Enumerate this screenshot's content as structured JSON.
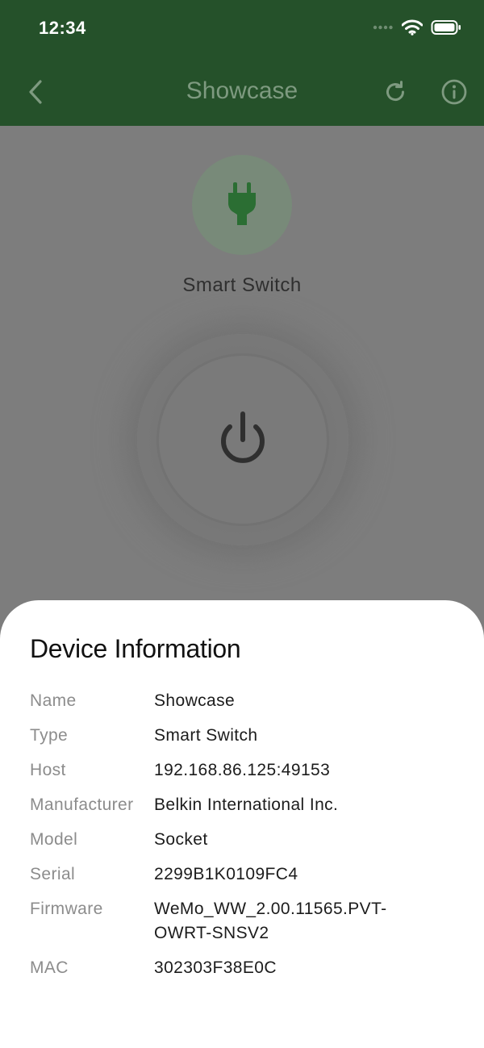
{
  "status_bar": {
    "time": "12:34",
    "icons": [
      "signal-dots-icon",
      "wifi-icon",
      "battery-icon"
    ]
  },
  "nav": {
    "title": "Showcase",
    "icons": [
      "back-chevron-icon",
      "refresh-icon",
      "info-icon"
    ]
  },
  "device": {
    "type_label": "Smart Switch",
    "icon": "plug-icon",
    "power_icon": "power-icon"
  },
  "colors": {
    "header_green": "#25512a",
    "accent_green": "#2b6e33",
    "scrim_gray": "#7d7d7d"
  },
  "sheet": {
    "title": "Device Information",
    "rows": [
      {
        "label": "Name",
        "value": "Showcase"
      },
      {
        "label": "Type",
        "value": "Smart Switch"
      },
      {
        "label": "Host",
        "value": "192.168.86.125:49153"
      },
      {
        "label": "Manufacturer",
        "value": "Belkin International Inc."
      },
      {
        "label": "Model",
        "value": "Socket"
      },
      {
        "label": "Serial",
        "value": "2299B1K0109FC4"
      },
      {
        "label": "Firmware",
        "value": "WeMo_WW_2.00.11565.PVT-OWRT-SNSV2"
      },
      {
        "label": "MAC",
        "value": "302303F38E0C"
      }
    ]
  }
}
